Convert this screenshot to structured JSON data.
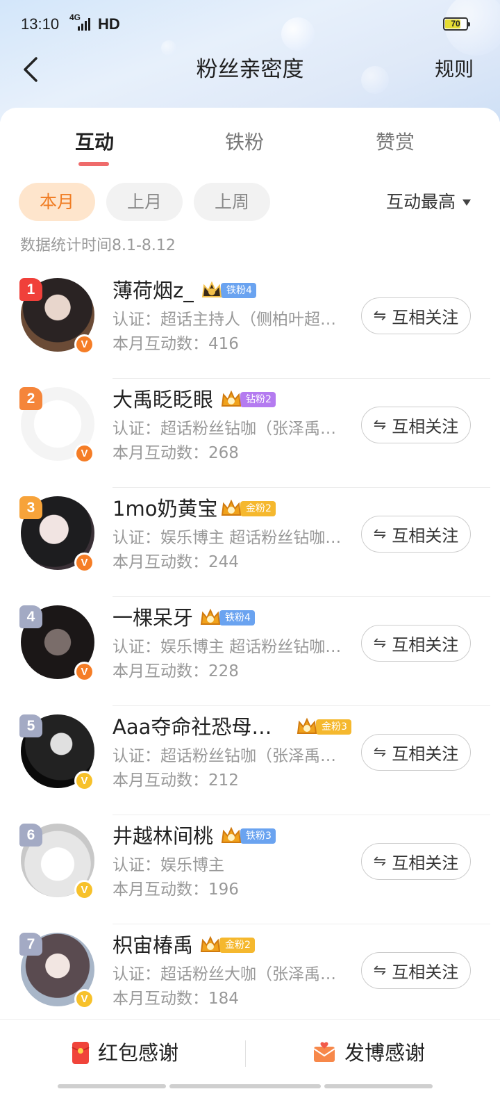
{
  "status": {
    "time": "13:10",
    "network": "4G",
    "hd": "HD",
    "battery": "70"
  },
  "header": {
    "title": "粉丝亲密度",
    "rules": "规则"
  },
  "tabs": [
    {
      "label": "互动"
    },
    {
      "label": "铁粉"
    },
    {
      "label": "赞赏"
    }
  ],
  "filters": [
    {
      "label": "本月"
    },
    {
      "label": "上月"
    },
    {
      "label": "上周"
    }
  ],
  "sort_label": "互动最高",
  "stat_text": "数据统计时间8.1-8.12",
  "follow_label": "互相关注",
  "fans": [
    {
      "rank": "1",
      "name": "薄荷烟z_",
      "badge": "铁粉4",
      "cert": "认证：超话主持人（侧柏叶超…",
      "count": "本月互动数：416"
    },
    {
      "rank": "2",
      "name": "大禹眨眨眼",
      "badge": "钻粉2",
      "cert": "认证：超话粉丝钻咖（张泽禹…",
      "count": "本月互动数：268"
    },
    {
      "rank": "3",
      "name": "1mo奶黄宝",
      "badge": "金粉2",
      "cert": "认证：娱乐博主 超话粉丝钻咖…",
      "count": "本月互动数：244"
    },
    {
      "rank": "4",
      "name": "一棵呆牙",
      "badge": "铁粉4",
      "cert": "认证：娱乐博主 超话粉丝钻咖…",
      "count": "本月互动数：228"
    },
    {
      "rank": "5",
      "name": "Aaa夺命社恐母…",
      "badge": "金粉3",
      "cert": "认证：超话粉丝钻咖（张泽禹…",
      "count": "本月互动数：212"
    },
    {
      "rank": "6",
      "name": "井越林间桃",
      "badge": "铁粉3",
      "cert": "认证：娱乐博主",
      "count": "本月互动数：196"
    },
    {
      "rank": "7",
      "name": "枳宙椿禹",
      "badge": "金粉2",
      "cert": "认证：超话粉丝大咖（张泽禹…",
      "count": "本月互动数：184"
    }
  ],
  "bottom": {
    "red_packet": "红包感谢",
    "post_thanks": "发博感谢"
  },
  "colors": {
    "accent": "#f07c22",
    "tab_indicator": "#ef6b6b",
    "iron": "#6aa3f0",
    "diamond": "#b47bf0",
    "gold": "#f5b82e"
  }
}
